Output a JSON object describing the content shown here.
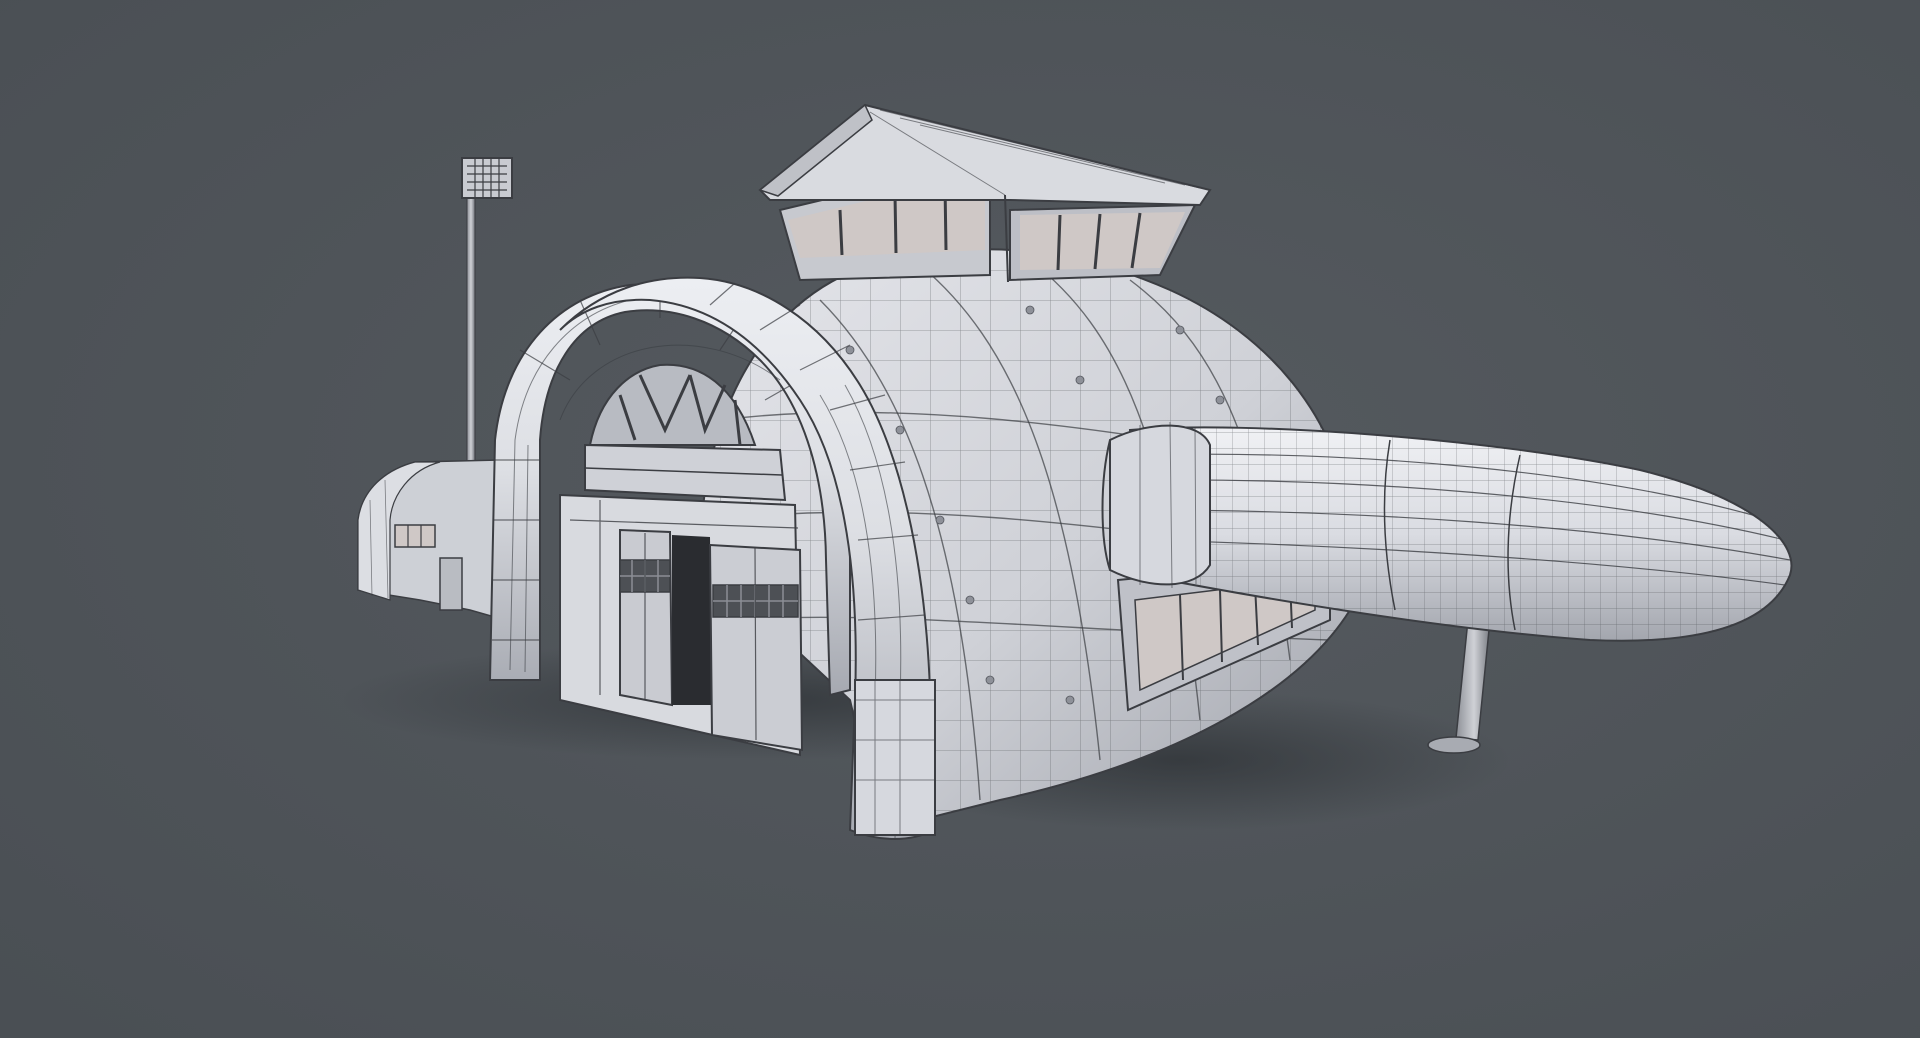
{
  "viewport": {
    "background": "#4a4f54",
    "background_center": "#555a5f"
  },
  "model": {
    "subject": "hangar",
    "material": {
      "base": "#dcdee3",
      "shade": "#a9abb3",
      "dark": "#63666d",
      "wire": "#3b3d42",
      "window": "#cfc8c6"
    }
  }
}
